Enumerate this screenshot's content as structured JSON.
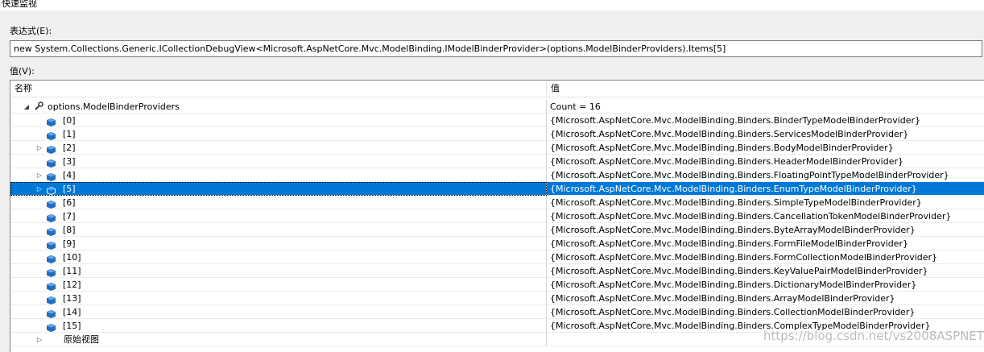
{
  "window": {
    "title": "快速监视"
  },
  "expression": {
    "label": "表达式(E):",
    "value": "new System.Collections.Generic.ICollectionDebugView<Microsoft.AspNetCore.Mvc.ModelBinding.IModelBinderProvider>(options.ModelBinderProviders).Items[5]"
  },
  "value_section": {
    "label": "值(V):"
  },
  "grid": {
    "columns": [
      "名称",
      "值"
    ],
    "rows": [
      {
        "name": "options.ModelBinderProviders",
        "value": "Count = 16",
        "icon": "wrench-icon",
        "expander": "expanded",
        "level": 0
      },
      {
        "name": "[0]",
        "value": "{Microsoft.AspNetCore.Mvc.ModelBinding.Binders.BinderTypeModelBinderProvider}",
        "icon": "object-icon",
        "expander": "none",
        "level": 1
      },
      {
        "name": "[1]",
        "value": "{Microsoft.AspNetCore.Mvc.ModelBinding.Binders.ServicesModelBinderProvider}",
        "icon": "object-icon",
        "expander": "none",
        "level": 1
      },
      {
        "name": "[2]",
        "value": "{Microsoft.AspNetCore.Mvc.ModelBinding.Binders.BodyModelBinderProvider}",
        "icon": "object-icon",
        "expander": "collapsed",
        "level": 1
      },
      {
        "name": "[3]",
        "value": "{Microsoft.AspNetCore.Mvc.ModelBinding.Binders.HeaderModelBinderProvider}",
        "icon": "object-icon",
        "expander": "none",
        "level": 1
      },
      {
        "name": "[4]",
        "value": "{Microsoft.AspNetCore.Mvc.ModelBinding.Binders.FloatingPointTypeModelBinderProvider}",
        "icon": "object-icon",
        "expander": "collapsed",
        "level": 1
      },
      {
        "name": "[5]",
        "value": "{Microsoft.AspNetCore.Mvc.ModelBinding.Binders.EnumTypeModelBinderProvider}",
        "icon": "object-icon",
        "expander": "collapsed",
        "level": 1,
        "selected": true
      },
      {
        "name": "[6]",
        "value": "{Microsoft.AspNetCore.Mvc.ModelBinding.Binders.SimpleTypeModelBinderProvider}",
        "icon": "object-icon",
        "expander": "none",
        "level": 1
      },
      {
        "name": "[7]",
        "value": "{Microsoft.AspNetCore.Mvc.ModelBinding.Binders.CancellationTokenModelBinderProvider}",
        "icon": "object-icon",
        "expander": "none",
        "level": 1
      },
      {
        "name": "[8]",
        "value": "{Microsoft.AspNetCore.Mvc.ModelBinding.Binders.ByteArrayModelBinderProvider}",
        "icon": "object-icon",
        "expander": "none",
        "level": 1
      },
      {
        "name": "[9]",
        "value": "{Microsoft.AspNetCore.Mvc.ModelBinding.Binders.FormFileModelBinderProvider}",
        "icon": "object-icon",
        "expander": "none",
        "level": 1
      },
      {
        "name": "[10]",
        "value": "{Microsoft.AspNetCore.Mvc.ModelBinding.Binders.FormCollectionModelBinderProvider}",
        "icon": "object-icon",
        "expander": "none",
        "level": 1
      },
      {
        "name": "[11]",
        "value": "{Microsoft.AspNetCore.Mvc.ModelBinding.Binders.KeyValuePairModelBinderProvider}",
        "icon": "object-icon",
        "expander": "none",
        "level": 1
      },
      {
        "name": "[12]",
        "value": "{Microsoft.AspNetCore.Mvc.ModelBinding.Binders.DictionaryModelBinderProvider}",
        "icon": "object-icon",
        "expander": "none",
        "level": 1
      },
      {
        "name": "[13]",
        "value": "{Microsoft.AspNetCore.Mvc.ModelBinding.Binders.ArrayModelBinderProvider}",
        "icon": "object-icon",
        "expander": "none",
        "level": 1
      },
      {
        "name": "[14]",
        "value": "{Microsoft.AspNetCore.Mvc.ModelBinding.Binders.CollectionModelBinderProvider}",
        "icon": "object-icon",
        "expander": "none",
        "level": 1
      },
      {
        "name": "[15]",
        "value": "{Microsoft.AspNetCore.Mvc.ModelBinding.Binders.ComplexTypeModelBinderProvider}",
        "icon": "object-icon",
        "expander": "none",
        "level": 1
      },
      {
        "name": "原始视图",
        "value": "",
        "icon": "raw-view-icon",
        "expander": "collapsed",
        "level": 1
      }
    ]
  },
  "watermark": {
    "text": "https://blog.csdn.net/vs2008ASPNET"
  },
  "colors": {
    "selection": "#0078d7",
    "object_icon": "#1e6fc2",
    "wrench_icon": "#3c3c3c"
  }
}
